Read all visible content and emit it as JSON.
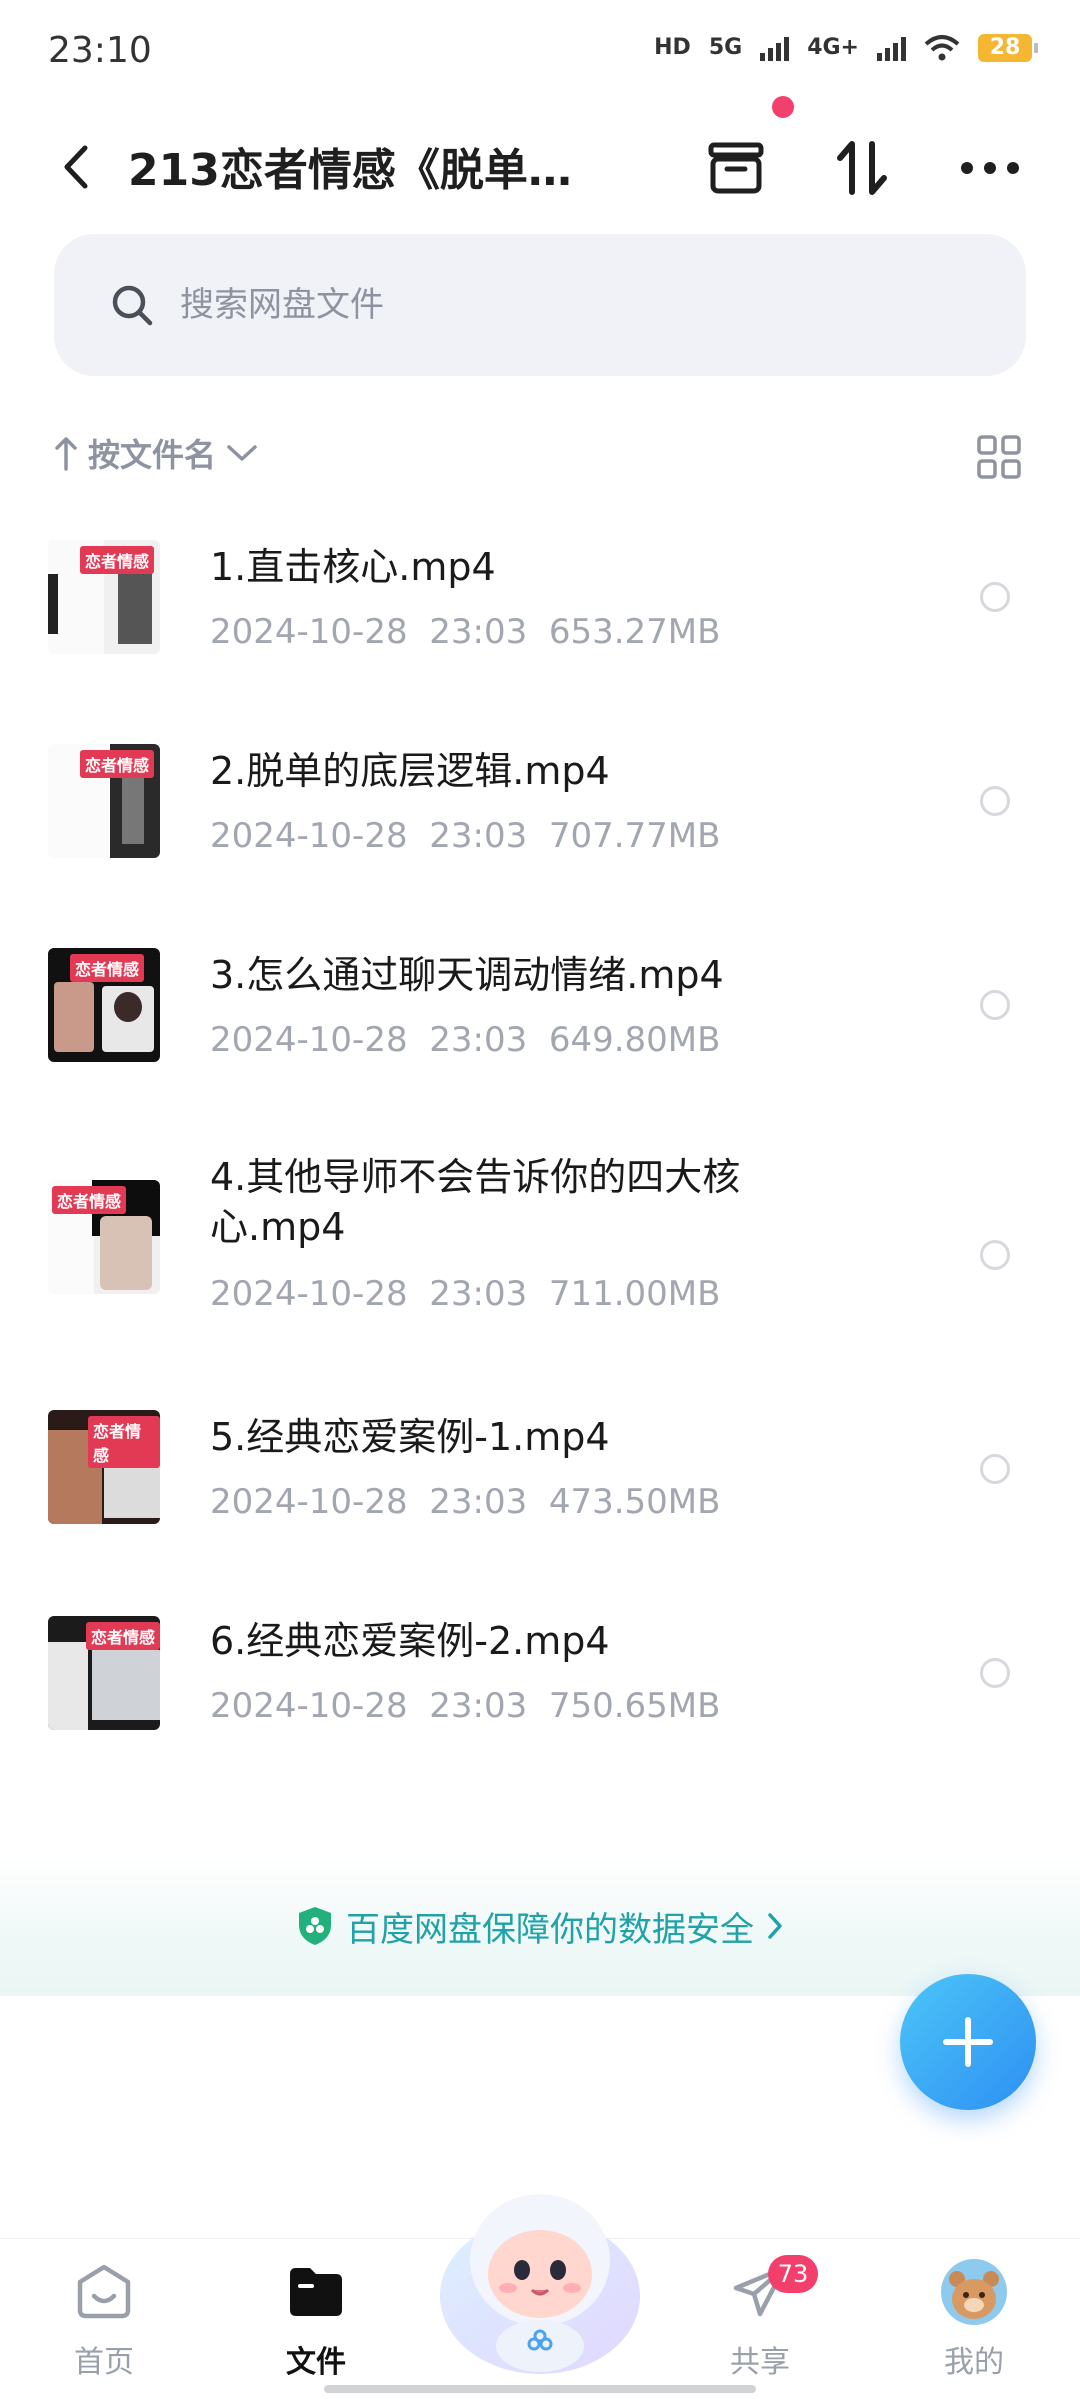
{
  "status_bar": {
    "time": "23:10",
    "hd": "HD",
    "net1": "5G",
    "net2": "4G+",
    "battery": "28"
  },
  "header": {
    "title": "213恋者情感《脱单…",
    "icons": [
      "back-icon",
      "archive-icon",
      "transfer-icon",
      "more-icon"
    ]
  },
  "search": {
    "placeholder": "搜索网盘文件"
  },
  "sort": {
    "label": "按文件名"
  },
  "files": [
    {
      "name": "1.直击核心.mp4",
      "date": "2024-10-28",
      "time": "23:03",
      "size": "653.27MB",
      "thumb_banner": "恋者情感"
    },
    {
      "name": "2.脱单的底层逻辑.mp4",
      "date": "2024-10-28",
      "time": "23:03",
      "size": "707.77MB",
      "thumb_banner": "恋者情感"
    },
    {
      "name": "3.怎么通过聊天调动情绪.mp4",
      "date": "2024-10-28",
      "time": "23:03",
      "size": "649.80MB",
      "thumb_banner": "恋者情感"
    },
    {
      "name": "4.其他导师不会告诉你的四大核心.mp4",
      "date": "2024-10-28",
      "time": "23:03",
      "size": "711.00MB",
      "thumb_banner": "恋者情感"
    },
    {
      "name": "5.经典恋爱案例-1.mp4",
      "date": "2024-10-28",
      "time": "23:03",
      "size": "473.50MB",
      "thumb_banner": "恋者情感"
    },
    {
      "name": "6.经典恋爱案例-2.mp4",
      "date": "2024-10-28",
      "time": "23:03",
      "size": "750.65MB",
      "thumb_banner": "恋者情感"
    }
  ],
  "security": {
    "text": "百度网盘保障你的数据安全"
  },
  "bottom_nav": {
    "home": "首页",
    "files": "文件",
    "share": "共享",
    "share_badge": "73",
    "mine": "我的"
  },
  "colors": {
    "accent": "#2e8ff2",
    "security": "#1fa2a8",
    "badge": "#f23f6b"
  }
}
